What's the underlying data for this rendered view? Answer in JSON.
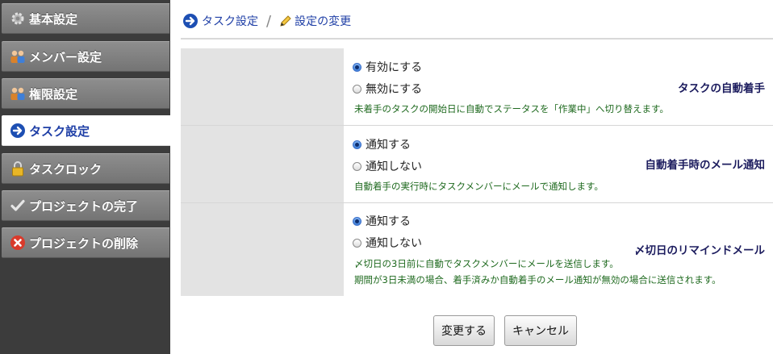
{
  "sidebar": {
    "items": [
      {
        "label": "基本設定",
        "icon": "gear-icon"
      },
      {
        "label": "メンバー設定",
        "icon": "members-icon"
      },
      {
        "label": "権限設定",
        "icon": "members-icon"
      },
      {
        "label": "タスク設定",
        "icon": "arrow-right-circle-icon",
        "active": true
      },
      {
        "label": "タスクロック",
        "icon": "lock-icon"
      },
      {
        "label": "プロジェクトの完了",
        "icon": "check-icon"
      },
      {
        "label": "プロジェクトの削除",
        "icon": "delete-icon"
      }
    ]
  },
  "breadcrumb": {
    "first": "タスク設定",
    "separator": "/",
    "second": "設定の変更"
  },
  "form": {
    "rows": [
      {
        "label": "タスクの自動着手",
        "options": [
          "有効にする",
          "無効にする"
        ],
        "selected": 0,
        "notes": [
          "未着手のタスクの開始日に自動でステータスを「作業中」へ切り替えます。"
        ]
      },
      {
        "label": "自動着手時のメール通知",
        "options": [
          "通知する",
          "通知しない"
        ],
        "selected": 0,
        "notes": [
          "自動着手の実行時にタスクメンバーにメールで通知します。"
        ]
      },
      {
        "label": "〆切日のリマインドメール",
        "options": [
          "通知する",
          "通知しない"
        ],
        "selected": 0,
        "notes": [
          "〆切日の3日前に自動でタスクメンバーにメールを送信します。",
          "期間が3日未満の場合、着手済みか自動着手のメール通知が無効の場合に送信されます。"
        ]
      }
    ]
  },
  "buttons": {
    "submit": "変更する",
    "cancel": "キャンセル"
  },
  "colors": {
    "link": "#1f3fa6",
    "note": "#1f6a1f",
    "label_bg": "#e3e3e3",
    "sidebar_bg": "#3c3c3c"
  }
}
